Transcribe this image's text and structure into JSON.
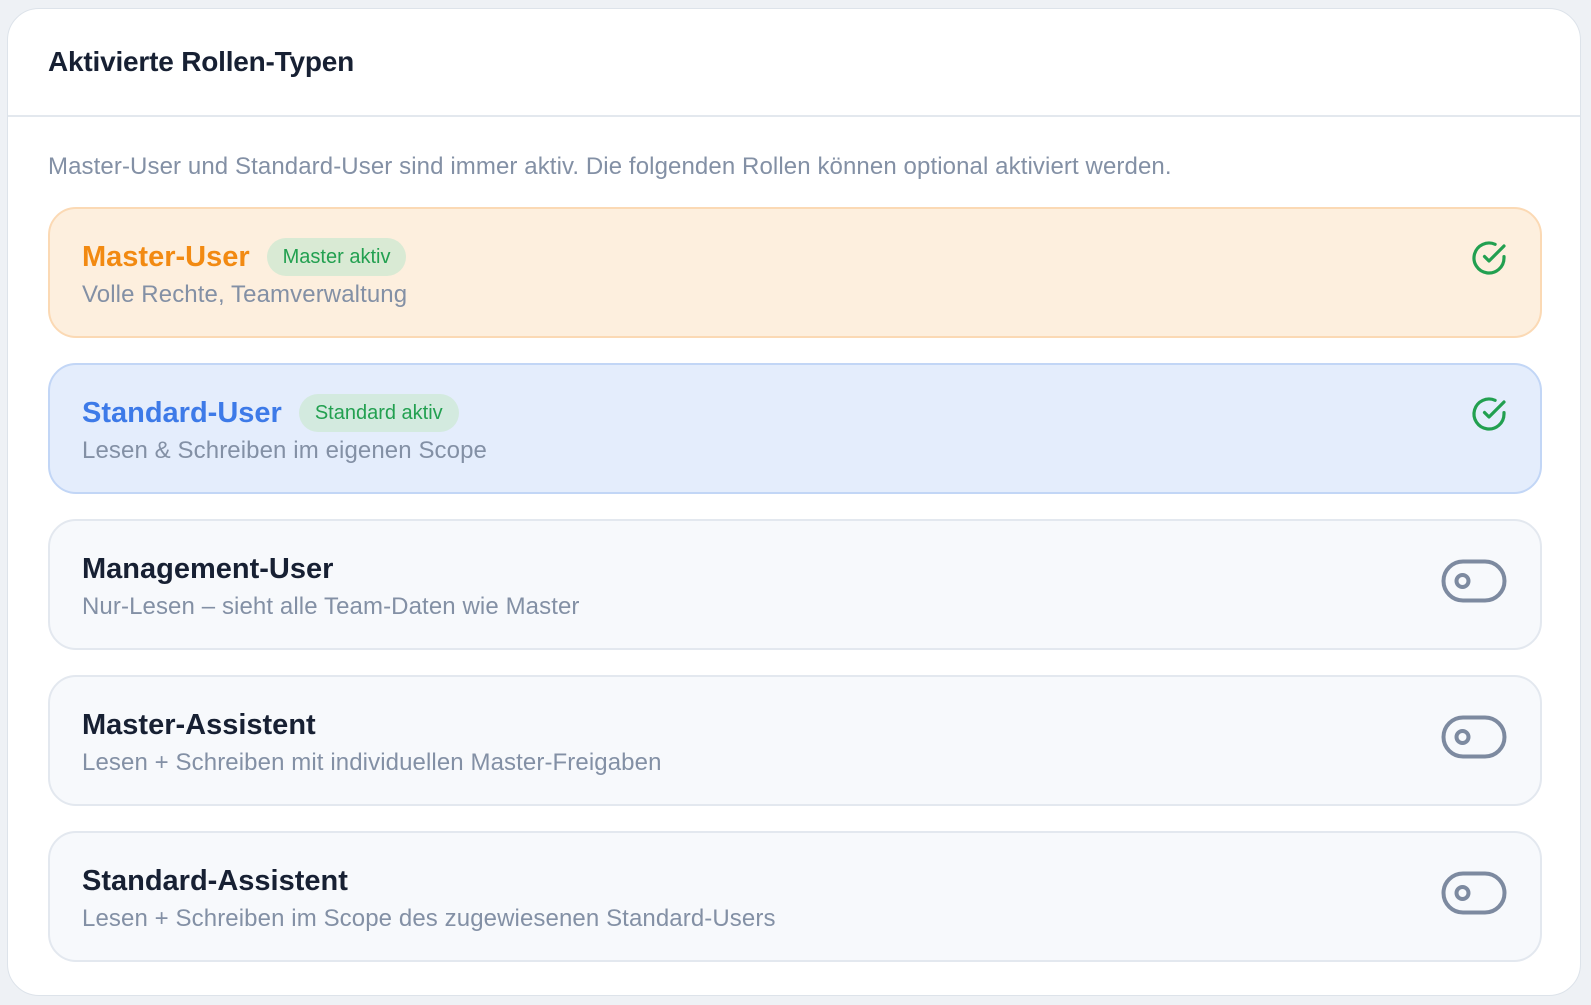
{
  "header": {
    "title": "Aktivierte Rollen-Typen"
  },
  "info_text": "Master-User und Standard-User sind immer aktiv. Die folgenden Rollen können optional aktiviert werden.",
  "colors": {
    "master_accent": "#f28a12",
    "standard_accent": "#3d7ae8",
    "active_green": "#22a050",
    "toggle_off": "#7d8aa0"
  },
  "roles": [
    {
      "name": "Master-User",
      "badge": "Master aktiv",
      "description": "Volle Rechte, Teamverwaltung",
      "status_icon": "check-circle-icon"
    },
    {
      "name": "Standard-User",
      "badge": "Standard aktiv",
      "description": "Lesen & Schreiben im eigenen Scope",
      "status_icon": "check-circle-icon"
    },
    {
      "name": "Management-User",
      "description": "Nur-Lesen – sieht alle Team-Daten wie Master",
      "enabled": false,
      "status_icon": "toggle-off-icon"
    },
    {
      "name": "Master-Assistent",
      "description": "Lesen + Schreiben mit individuellen Master-Freigaben",
      "enabled": false,
      "status_icon": "toggle-off-icon"
    },
    {
      "name": "Standard-Assistent",
      "description": "Lesen + Schreiben im Scope des zugewiesenen Standard-Users",
      "enabled": false,
      "status_icon": "toggle-off-icon"
    }
  ]
}
